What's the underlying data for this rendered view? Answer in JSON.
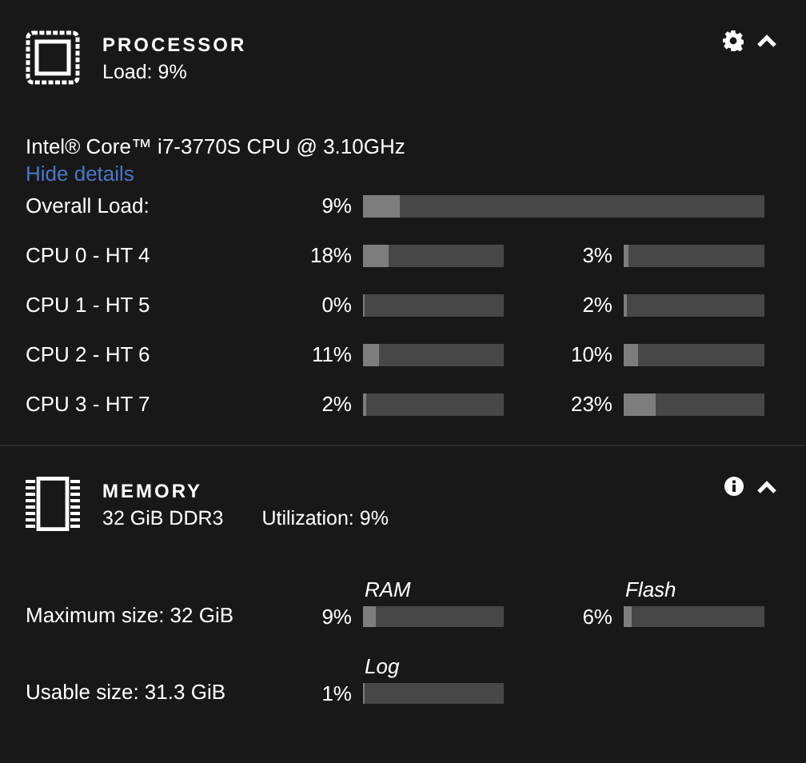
{
  "processor": {
    "title": "PROCESSOR",
    "load": "Load: 9%",
    "cpu_name": "Intel® Core™ i7-3770S CPU @ 3.10GHz",
    "details_link": "Hide details",
    "overall": {
      "label": "Overall Load:",
      "reading": "9%",
      "level": 0.09
    },
    "cores": [
      {
        "label": "CPU 0 - HT 4",
        "threads": [
          {
            "reading": "18%",
            "level": 0.18
          },
          {
            "reading": "3%",
            "level": 0.03
          }
        ]
      },
      {
        "label": "CPU 1 - HT 5",
        "threads": [
          {
            "reading": "0%",
            "level": 0
          },
          {
            "reading": "2%",
            "level": 0.02
          }
        ]
      },
      {
        "label": "CPU 2 - HT 6",
        "threads": [
          {
            "reading": "11%",
            "level": 0.11
          },
          {
            "reading": "10%",
            "level": 0.1
          }
        ]
      },
      {
        "label": "CPU 3 - HT 7",
        "threads": [
          {
            "reading": "2%",
            "level": 0.02
          },
          {
            "reading": "23%",
            "level": 0.23
          }
        ]
      }
    ]
  },
  "memory": {
    "title": "MEMORY",
    "size": "32 GiB DDR3",
    "utilization": "Utilization: 9%",
    "rows": [
      {
        "label": "Maximum size: 32 GiB",
        "meters": [
          {
            "caption": "RAM",
            "reading": "9%",
            "level": 0.09
          },
          {
            "caption": "Flash",
            "reading": "6%",
            "level": 0.06
          }
        ]
      },
      {
        "label": "Usable size: 31.3 GiB",
        "meters": [
          {
            "caption": "Log",
            "reading": "1%",
            "level": 0.01
          }
        ]
      }
    ]
  }
}
